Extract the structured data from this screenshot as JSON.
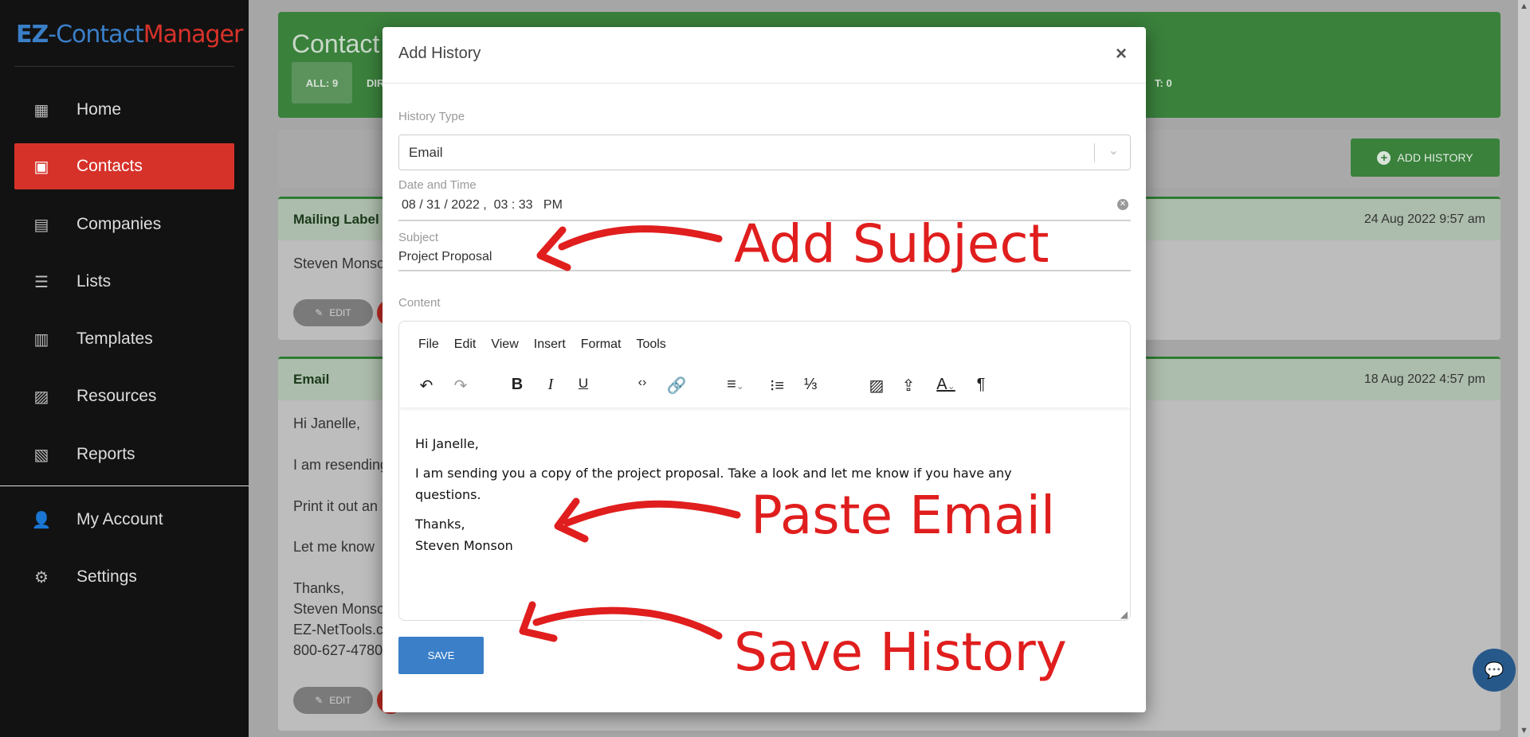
{
  "logo": {
    "ez": "EZ",
    "contact": "-Contact",
    "manager": "Manager"
  },
  "sidebar": {
    "items": [
      {
        "label": "Home",
        "icon": "dashboard-icon"
      },
      {
        "label": "Contacts",
        "icon": "contacts-icon",
        "active": true
      },
      {
        "label": "Companies",
        "icon": "building-icon"
      },
      {
        "label": "Lists",
        "icon": "list-icon"
      },
      {
        "label": "Templates",
        "icon": "template-icon"
      },
      {
        "label": "Resources",
        "icon": "image-icon"
      },
      {
        "label": "Reports",
        "icon": "clipboard-icon"
      }
    ],
    "bottom": [
      {
        "label": "My Account",
        "icon": "user-gear-icon"
      },
      {
        "label": "Settings",
        "icon": "gear-icon"
      }
    ]
  },
  "header": {
    "title": "Contact",
    "filters": {
      "all": "ALL: 9",
      "dir": "DIR",
      "last": "T: 0"
    }
  },
  "toolbar": {
    "add_history": "ADD HISTORY"
  },
  "cards": [
    {
      "title": "Mailing Label",
      "date": "24 Aug 2022 9:57 am",
      "lines": [
        "Steven Monson"
      ],
      "edit": "EDIT"
    },
    {
      "title": "Email",
      "date": "18 Aug 2022 4:57 pm",
      "lines": [
        "Hi Janelle,",
        "I am resending",
        "Print it out an",
        "Let me know",
        "Thanks,",
        "Steven Monson",
        "EZ-NetTools.c",
        "800-627-4780"
      ],
      "edit": "EDIT"
    }
  ],
  "modal": {
    "title": "Add History",
    "close": "×",
    "history_type_label": "History Type",
    "history_type": "Email",
    "date_label": "Date and Time",
    "date_value": "08 / 31 / 2022 ,  03 : 33   PM",
    "subject_label": "Subject",
    "subject": "Project Proposal",
    "content_label": "Content",
    "menu": [
      "File",
      "Edit",
      "View",
      "Insert",
      "Format",
      "Tools"
    ],
    "content": [
      "Hi Janelle,",
      "I am sending you a copy of the project proposal.  Take a look and let me know if you have any questions.",
      "Thanks,",
      "Steven Monson"
    ],
    "save": "SAVE"
  },
  "annotations": {
    "subject": "Add Subject",
    "paste": "Paste Email",
    "save": "Save History"
  },
  "colors": {
    "accent_red": "#d6322a",
    "green": "#3a813c",
    "blue": "#3a7fc8",
    "annotation": "#e01e1e"
  }
}
